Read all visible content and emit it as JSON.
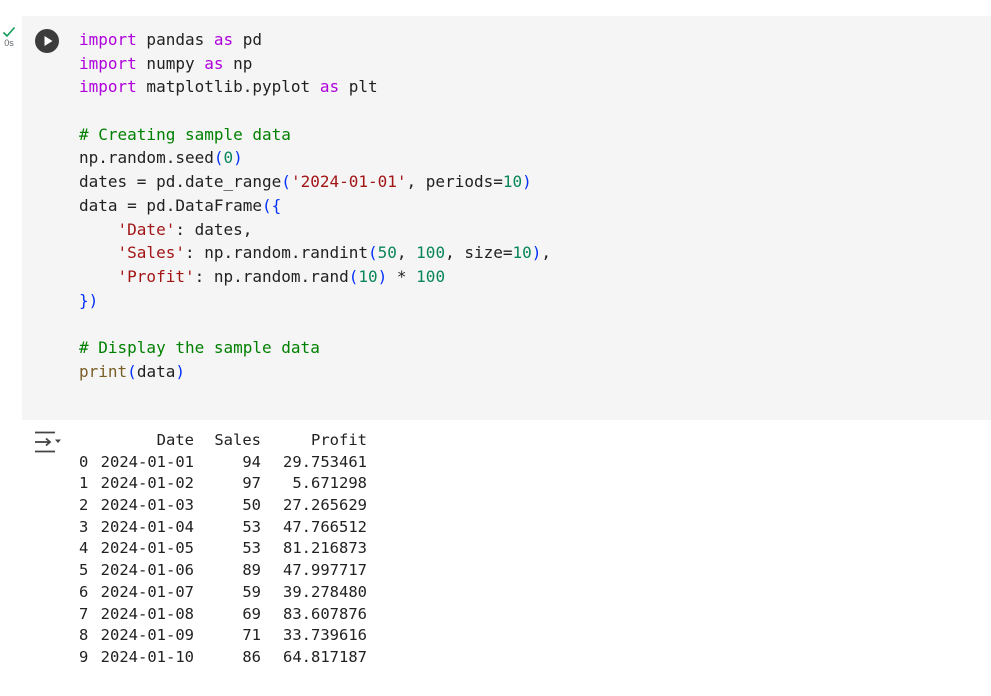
{
  "cell": {
    "status": {
      "check_icon": "check-icon",
      "exec_time": "0s"
    },
    "run_icon": "play-circle-icon",
    "code_lines": [
      [
        {
          "t": "import",
          "c": "kw"
        },
        {
          "t": " pandas "
        },
        {
          "t": "as",
          "c": "kw"
        },
        {
          "t": " pd"
        }
      ],
      [
        {
          "t": "import",
          "c": "kw"
        },
        {
          "t": " numpy "
        },
        {
          "t": "as",
          "c": "kw"
        },
        {
          "t": " np"
        }
      ],
      [
        {
          "t": "import",
          "c": "kw"
        },
        {
          "t": " matplotlib.pyplot "
        },
        {
          "t": "as",
          "c": "kw"
        },
        {
          "t": " plt"
        }
      ],
      [],
      [
        {
          "t": "# Creating sample data",
          "c": "cm"
        }
      ],
      [
        {
          "t": "np.random.seed"
        },
        {
          "t": "(",
          "c": "br"
        },
        {
          "t": "0",
          "c": "num"
        },
        {
          "t": ")",
          "c": "br"
        }
      ],
      [
        {
          "t": "dates = pd.date_range"
        },
        {
          "t": "(",
          "c": "br"
        },
        {
          "t": "'2024-01-01'",
          "c": "str"
        },
        {
          "t": ", periods="
        },
        {
          "t": "10",
          "c": "num"
        },
        {
          "t": ")",
          "c": "br"
        }
      ],
      [
        {
          "t": "data = pd.DataFrame"
        },
        {
          "t": "({",
          "c": "br"
        }
      ],
      [
        {
          "t": "    "
        },
        {
          "t": "'Date'",
          "c": "str"
        },
        {
          "t": ": dates,"
        }
      ],
      [
        {
          "t": "    "
        },
        {
          "t": "'Sales'",
          "c": "str"
        },
        {
          "t": ": np.random.randint"
        },
        {
          "t": "(",
          "c": "br"
        },
        {
          "t": "50",
          "c": "num"
        },
        {
          "t": ", "
        },
        {
          "t": "100",
          "c": "num"
        },
        {
          "t": ", size="
        },
        {
          "t": "10",
          "c": "num"
        },
        {
          "t": ")",
          "c": "br"
        },
        {
          "t": ","
        }
      ],
      [
        {
          "t": "    "
        },
        {
          "t": "'Profit'",
          "c": "str"
        },
        {
          "t": ": np.random.rand"
        },
        {
          "t": "(",
          "c": "br"
        },
        {
          "t": "10",
          "c": "num"
        },
        {
          "t": ")",
          "c": "br"
        },
        {
          "t": " * "
        },
        {
          "t": "100",
          "c": "num"
        }
      ],
      [
        {
          "t": "})",
          "c": "br"
        }
      ],
      [],
      [
        {
          "t": "# Display the sample data",
          "c": "cm"
        }
      ],
      [
        {
          "t": "print",
          "c": "fn"
        },
        {
          "t": "(",
          "c": "br"
        },
        {
          "t": "data"
        },
        {
          "t": ")",
          "c": "br"
        }
      ]
    ]
  },
  "output": {
    "toggle_icon": "output-collapse-icon",
    "columns": {
      "index": "",
      "date": "Date",
      "sales": "Sales",
      "profit": "Profit"
    },
    "rows": [
      {
        "index": "0",
        "date": "2024-01-01",
        "sales": "94",
        "profit": "29.753461"
      },
      {
        "index": "1",
        "date": "2024-01-02",
        "sales": "97",
        "profit": "5.671298"
      },
      {
        "index": "2",
        "date": "2024-01-03",
        "sales": "50",
        "profit": "27.265629"
      },
      {
        "index": "3",
        "date": "2024-01-04",
        "sales": "53",
        "profit": "47.766512"
      },
      {
        "index": "4",
        "date": "2024-01-05",
        "sales": "53",
        "profit": "81.216873"
      },
      {
        "index": "5",
        "date": "2024-01-06",
        "sales": "89",
        "profit": "47.997717"
      },
      {
        "index": "6",
        "date": "2024-01-07",
        "sales": "59",
        "profit": "39.278480"
      },
      {
        "index": "7",
        "date": "2024-01-08",
        "sales": "69",
        "profit": "83.607876"
      },
      {
        "index": "8",
        "date": "2024-01-09",
        "sales": "71",
        "profit": "33.739616"
      },
      {
        "index": "9",
        "date": "2024-01-10",
        "sales": "86",
        "profit": "64.817187"
      }
    ]
  },
  "colors": {
    "cell_background": "#f5f5f5",
    "keyword": "#af00db",
    "comment": "#008000",
    "string": "#a31515",
    "number": "#098658",
    "bracket": "#0431fa",
    "builtin": "#795e26",
    "success": "#0f9d58"
  }
}
